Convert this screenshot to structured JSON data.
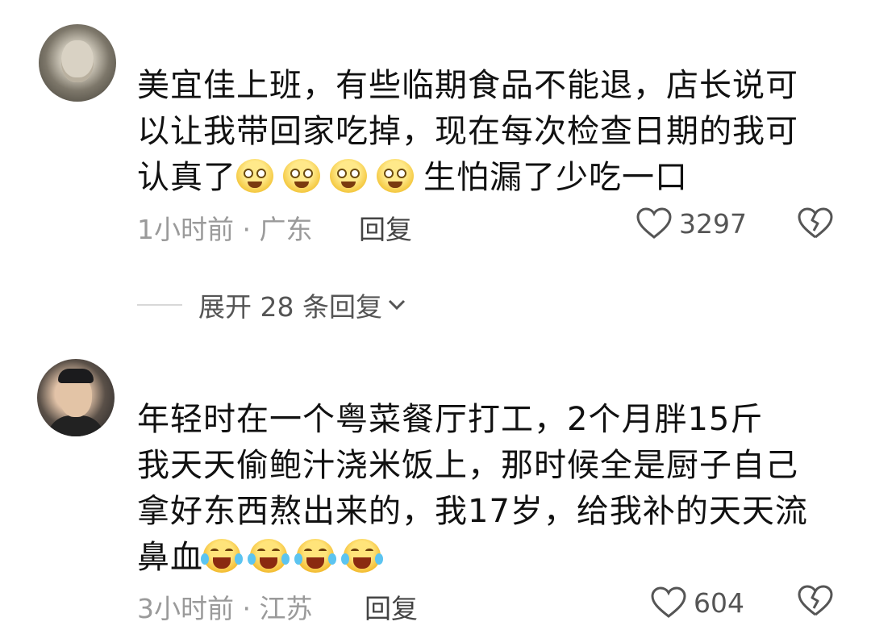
{
  "comments": [
    {
      "lines": [
        "美宜佳上班，有些临期食品不能退，店长说可",
        "以让我带回家吃掉，现在每次检查日期的我可"
      ],
      "last_line_prefix": "认真了",
      "last_line_suffix": "生怕漏了少吃一口",
      "emoji_icons": [
        "grin-emoji-icon",
        "grin-emoji-icon",
        "grin-emoji-icon",
        "grin-emoji-icon"
      ],
      "time_location": "1小时前 · 广东",
      "reply_label": "回复",
      "likes": "3297"
    },
    {
      "lines": [
        "年轻时在一个粤菜餐厅打工，2个月胖15斤",
        "我天天偷鲍汁浇米饭上，那时候全是厨子自己",
        "拿好东西熬出来的，我17岁，给我补的天天流"
      ],
      "last_line_prefix": "鼻血",
      "emoji_icons": [
        "laugh-cry-emoji-icon",
        "laugh-cry-emoji-icon",
        "laugh-cry-emoji-icon",
        "laugh-cry-emoji-icon"
      ],
      "time_location": "3小时前 · 江苏",
      "reply_label": "回复",
      "likes": "604"
    }
  ],
  "expand_replies": "展开 28 条回复",
  "colors": {
    "meta": "#9a9a9a",
    "text": "#111111",
    "emoji": "#f3c53a"
  }
}
